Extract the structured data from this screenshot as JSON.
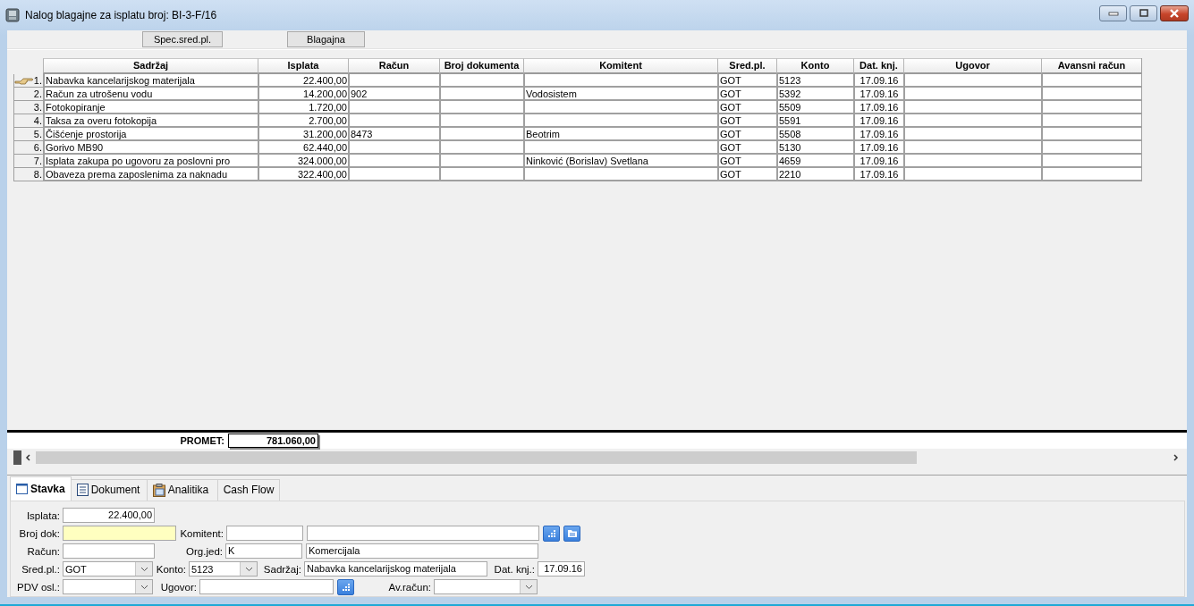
{
  "window": {
    "title": "Nalog blagajne za isplatu broj: BI-3-F/16"
  },
  "toolbar": [
    {
      "label": "Spec.sred.pl."
    },
    {
      "label": "Blagajna"
    }
  ],
  "table": {
    "columns": [
      "Sadržaj",
      "Isplata",
      "Račun",
      "Broj dokumenta",
      "Komitent",
      "Sred.pl.",
      "Konto",
      "Dat. knj.",
      "Ugovor",
      "Avansni račun"
    ],
    "rows": [
      {
        "number": "1.",
        "current": true,
        "cells": [
          "Nabavka kancelarijskog materijala",
          "22.400,00",
          "",
          "",
          "",
          "GOT",
          "5123",
          "17.09.16",
          "",
          ""
        ]
      },
      {
        "number": "2.",
        "current": false,
        "cells": [
          "Račun za utrošenu vodu",
          "14.200,00",
          "902",
          "",
          "Vodosistem",
          "GOT",
          "5392",
          "17.09.16",
          "",
          ""
        ]
      },
      {
        "number": "3.",
        "current": false,
        "cells": [
          "Fotokopiranje",
          "1.720,00",
          "",
          "",
          "",
          "GOT",
          "5509",
          "17.09.16",
          "",
          ""
        ]
      },
      {
        "number": "4.",
        "current": false,
        "cells": [
          "Taksa za overu fotokopija",
          "2.700,00",
          "",
          "",
          "",
          "GOT",
          "5591",
          "17.09.16",
          "",
          ""
        ]
      },
      {
        "number": "5.",
        "current": false,
        "cells": [
          "Čišćenje prostorija",
          "31.200,00",
          "8473",
          "",
          "Beotrim",
          "GOT",
          "5508",
          "17.09.16",
          "",
          ""
        ]
      },
      {
        "number": "6.",
        "current": false,
        "cells": [
          "Gorivo MB90",
          "62.440,00",
          "",
          "",
          "",
          "GOT",
          "5130",
          "17.09.16",
          "",
          ""
        ]
      },
      {
        "number": "7.",
        "current": false,
        "cells": [
          "Isplata zakupa po ugovoru za poslovni pro",
          "324.000,00",
          "",
          "",
          "Ninković (Borislav) Svetlana",
          "GOT",
          "4659",
          "17.09.16",
          "",
          ""
        ]
      },
      {
        "number": "8.",
        "current": false,
        "cells": [
          "Obaveza prema zaposlenima za naknadu",
          "322.400,00",
          "",
          "",
          "",
          "GOT",
          "2210",
          "17.09.16",
          "",
          ""
        ]
      }
    ],
    "total": {
      "label": "PROMET:",
      "value": "781.060,00"
    }
  },
  "tabs": [
    {
      "label": "Stavka",
      "selected": true
    },
    {
      "label": "Dokument",
      "selected": false
    },
    {
      "label": "Analitika",
      "selected": false
    },
    {
      "label": "Cash Flow",
      "selected": false
    }
  ],
  "form": {
    "isplata": {
      "label": "Isplata:",
      "value": "22.400,00",
      "focused": false
    },
    "broj_dok": {
      "label": "Broj dok:",
      "focused": true
    },
    "komitent": {
      "label": "Komitent:"
    },
    "racun": {
      "label": "Račun:",
      "focused": false
    },
    "org_jed": {
      "label": "Org.jed:",
      "code": "K",
      "name": "Komercijala"
    },
    "sred_pl": {
      "label": "Sred.pl.:",
      "value": "GOT"
    },
    "konto": {
      "label": "Konto:",
      "value": "5123"
    },
    "sadrzaj": {
      "label": "Sadržaj:",
      "value": "Nabavka kancelarijskog materijala"
    },
    "dat_knj": {
      "label": "Dat. knj.:",
      "value": "17.09.16"
    },
    "pdv_osl": {
      "label": "PDV osl.:"
    },
    "ugovor": {
      "label": "Ugovor:"
    },
    "av_racun": {
      "label": "Av.račun:"
    }
  }
}
